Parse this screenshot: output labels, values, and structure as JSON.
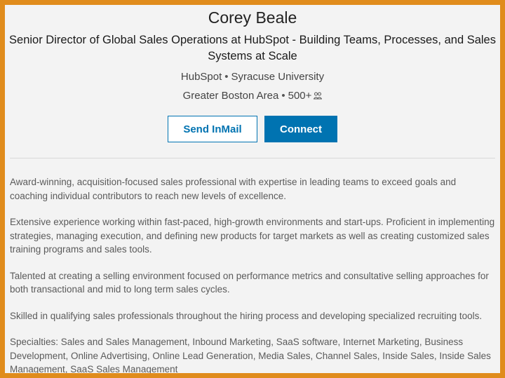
{
  "profile": {
    "name": "Corey Beale",
    "headline": "Senior Director of Global Sales Operations at HubSpot - Building Teams, Processes, and Sales Systems at Scale",
    "company": "HubSpot",
    "school": "Syracuse University",
    "location": "Greater Boston Area",
    "connections": "500+",
    "separator": "•",
    "connections_icon": "people-icon"
  },
  "actions": {
    "inmail_label": "Send InMail",
    "connect_label": "Connect"
  },
  "summary": {
    "paragraphs": [
      "Award-winning, acquisition-focused sales professional with expertise in leading teams to exceed goals and coaching individual contributors to reach new levels of excellence.",
      "Extensive experience working within fast-paced, high-growth environments and start-ups. Proficient in implementing strategies, managing execution, and defining new products for target markets as well as creating customized sales training programs and sales tools.",
      "Talented at creating a selling environment focused on performance metrics and consultative selling approaches for both transactional and mid to long term sales cycles.",
      "Skilled in qualifying sales professionals throughout the hiring process and developing specialized recruiting tools.",
      "Specialties: Sales and Sales Management, Inbound Marketing, SaaS software, Internet Marketing, Business Development, Online Advertising, Online Lead Generation, Media Sales, Channel Sales, Inside Sales, Inside Sales Management, SaaS Sales Management"
    ]
  },
  "colors": {
    "border": "#e08c1c",
    "background": "#f3f3f3",
    "accent": "#0073b1"
  }
}
